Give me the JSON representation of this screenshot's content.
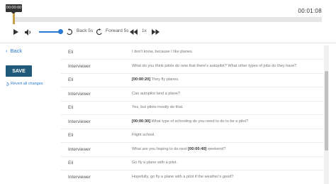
{
  "player": {
    "current_time": "00:00:00",
    "end_time": "00:01:08",
    "progress": 0.0,
    "volume": 1.0,
    "back_label": "Back 5s",
    "forward_label": "Forward 5s",
    "speed_label": "1x"
  },
  "sidebar": {
    "back_label": "Back",
    "save_label": "SAVE",
    "revert_label": "Revert all changes"
  },
  "transcript": [
    {
      "speaker": "Eli",
      "timestamp": "",
      "text": "I don't know, because I like planes."
    },
    {
      "speaker": "Interviewer",
      "timestamp": "",
      "text": "What do you think pilots do now that there's autopilot? What other types of jobs do they have?"
    },
    {
      "speaker": "Eli",
      "timestamp": "[00:00:20]",
      "text": "They fly planes."
    },
    {
      "speaker": "Interviewer",
      "timestamp": "",
      "text": "Can autopilot land a plane?"
    },
    {
      "speaker": "Eli",
      "timestamp": "",
      "text": "Yes, but pilots mostly do that."
    },
    {
      "speaker": "Interviewer",
      "timestamp": "[00:00:30]",
      "text": "What type of schooling do you need to do to be a pilot?"
    },
    {
      "speaker": "Eli",
      "timestamp": "",
      "text": "Flight school."
    },
    {
      "speaker": "Interviewer",
      "timestamp": "",
      "text": "What are you hoping to do next [00:00:40] weekend?"
    },
    {
      "speaker": "Eli",
      "timestamp": "",
      "text": "Go fly a plane with a pilot."
    },
    {
      "speaker": "Interviewer",
      "timestamp": "",
      "text": "Hopefully, go fly a plane with a pilot if the weather's good?"
    }
  ],
  "colors": {
    "accent": "#2a7ad4",
    "save_button": "#1f5a7a",
    "playhead": "#c7a04a"
  }
}
